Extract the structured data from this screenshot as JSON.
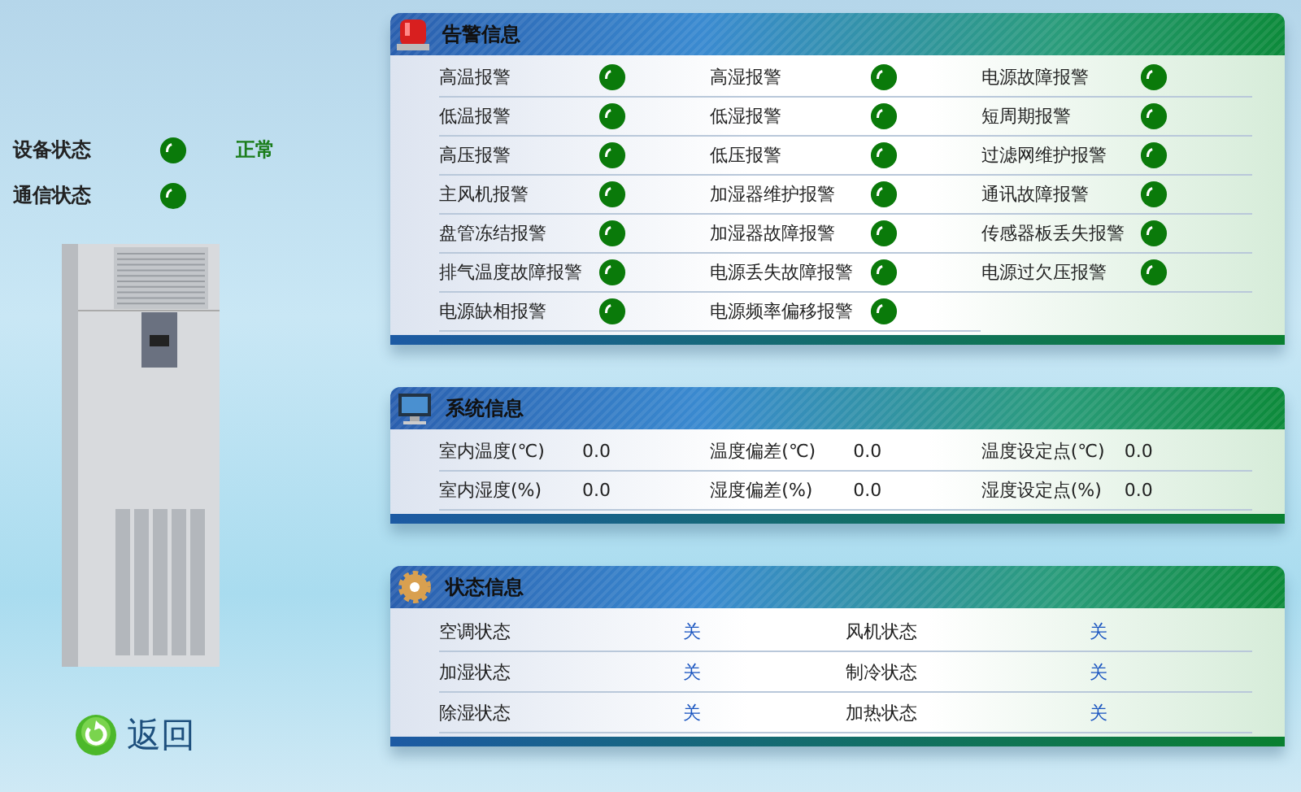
{
  "device": [
    {
      "label": "设备状态",
      "ok": true,
      "text": "正常"
    },
    {
      "label": "通信状态",
      "ok": true
    }
  ],
  "back_button": {
    "label": "返回"
  },
  "alarm_panel": {
    "title": "告警信息",
    "items": [
      {
        "label": "高温报警",
        "active": false
      },
      {
        "label": "高湿报警",
        "active": false
      },
      {
        "label": "电源故障报警",
        "active": false
      },
      {
        "label": "低温报警",
        "active": false
      },
      {
        "label": "低湿报警",
        "active": false
      },
      {
        "label": "短周期报警",
        "active": false
      },
      {
        "label": "高压报警",
        "active": false
      },
      {
        "label": "低压报警",
        "active": false
      },
      {
        "label": "过滤网维护报警",
        "active": false
      },
      {
        "label": "主风机报警",
        "active": false
      },
      {
        "label": "加湿器维护报警",
        "active": false
      },
      {
        "label": "通讯故障报警",
        "active": false
      },
      {
        "label": "盘管冻结报警",
        "active": false
      },
      {
        "label": "加湿器故障报警",
        "active": false
      },
      {
        "label": "传感器板丢失报警",
        "active": false
      },
      {
        "label": "排气温度故障报警",
        "active": false
      },
      {
        "label": "电源丢失故障报警",
        "active": false
      },
      {
        "label": "电源过欠压报警",
        "active": false
      },
      {
        "label": "电源缺相报警",
        "active": false
      },
      {
        "label": "电源频率偏移报警",
        "active": false
      }
    ]
  },
  "system_panel": {
    "title": "系统信息",
    "items": [
      {
        "label": "室内温度(℃)",
        "value": "0.0"
      },
      {
        "label": "温度偏差(℃)",
        "value": "0.0"
      },
      {
        "label": "温度设定点(℃)",
        "value": "0.0"
      },
      {
        "label": "室内湿度(%)",
        "value": "0.0"
      },
      {
        "label": "湿度偏差(%)",
        "value": "0.0"
      },
      {
        "label": "湿度设定点(%)",
        "value": "0.0"
      }
    ]
  },
  "status_panel": {
    "title": "状态信息",
    "items": [
      {
        "label": "空调状态",
        "value": "关"
      },
      {
        "label": "风机状态",
        "value": "关"
      },
      {
        "label": "加湿状态",
        "value": "关"
      },
      {
        "label": "制冷状态",
        "value": "关"
      },
      {
        "label": "除湿状态",
        "value": "关"
      },
      {
        "label": "加热状态",
        "value": "关"
      }
    ]
  }
}
